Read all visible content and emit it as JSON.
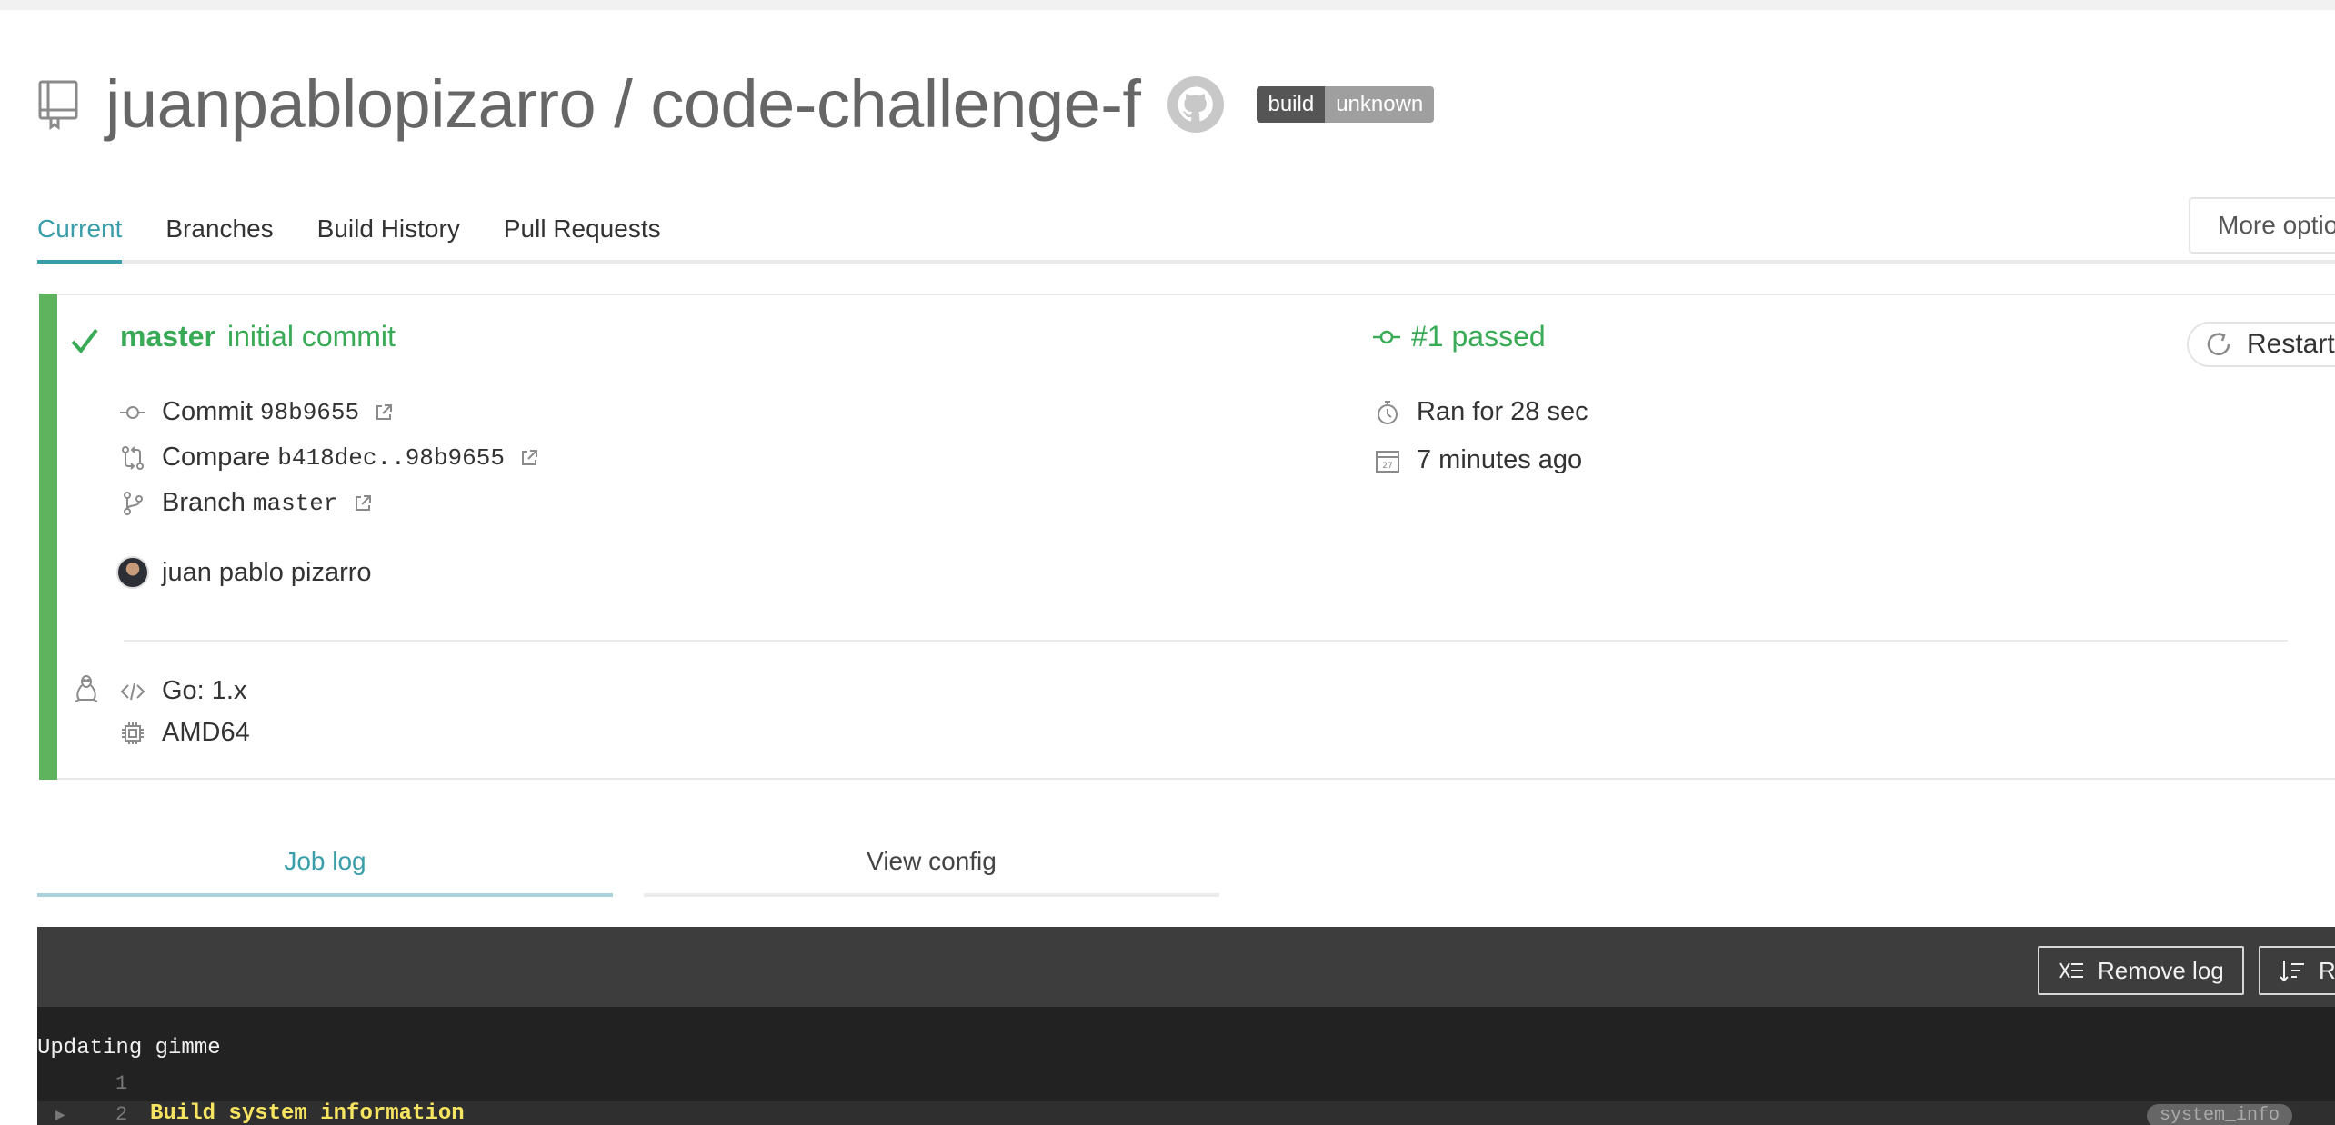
{
  "header": {
    "repo_title": "juanpablopizarro / code-challenge-f",
    "badge_left": "build",
    "badge_right": "unknown"
  },
  "tabs": [
    {
      "label": "Current",
      "active": true
    },
    {
      "label": "Branches"
    },
    {
      "label": "Build History"
    },
    {
      "label": "Pull Requests"
    }
  ],
  "more_options_label": "More option",
  "build": {
    "branch": "master",
    "commit_message": "initial commit",
    "status": "#1 passed",
    "status_color": "#39aa56",
    "commit_label": "Commit",
    "commit_sha": "98b9655",
    "compare_label": "Compare",
    "compare_range": "b418dec..98b9655",
    "branch_label": "Branch",
    "branch_value": "master",
    "author": "juan pablo pizarro",
    "duration": "Ran for 28 sec",
    "finished": "7 minutes ago",
    "restart_label": "Restart",
    "language": "Go: 1.x",
    "arch": "AMD64"
  },
  "log_tabs": {
    "job_log": "Job log",
    "view_config": "View config"
  },
  "log_toolbar": {
    "remove_log": "Remove log",
    "raw_log": "R"
  },
  "log": {
    "line0": "Updating gimme",
    "line1_num": "1",
    "line2_num": "2",
    "line2_text": "Build system information",
    "line2_tag": "system_info"
  }
}
